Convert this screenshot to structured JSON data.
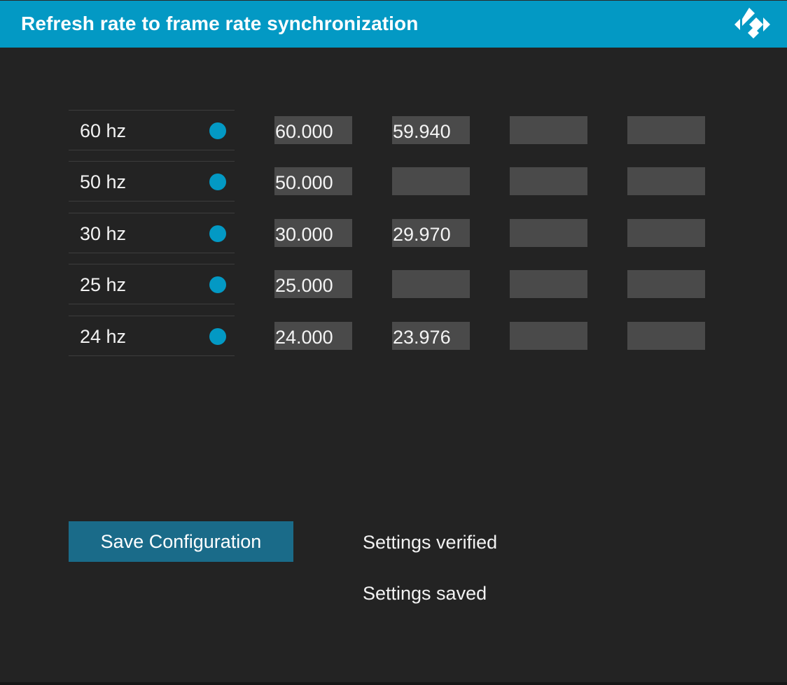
{
  "header": {
    "title": "Refresh rate to frame rate synchronization",
    "logo_icon": "kodi-logo-icon",
    "background_color": "#0399c4"
  },
  "rates": [
    {
      "label": "60 hz",
      "enabled": true,
      "fields": [
        "60.000",
        "59.940",
        "",
        ""
      ]
    },
    {
      "label": "50 hz",
      "enabled": true,
      "fields": [
        "50.000",
        "",
        "",
        ""
      ]
    },
    {
      "label": "30 hz",
      "enabled": true,
      "fields": [
        "30.000",
        "29.970",
        "",
        ""
      ]
    },
    {
      "label": "25 hz",
      "enabled": true,
      "fields": [
        "25.000",
        "",
        "",
        ""
      ]
    },
    {
      "label": "24 hz",
      "enabled": true,
      "fields": [
        "24.000",
        "23.976",
        "",
        ""
      ]
    }
  ],
  "actions": {
    "save_label": "Save Configuration"
  },
  "status": {
    "line1": "Settings verified",
    "line2": "Settings saved"
  },
  "colors": {
    "accent": "#0399c4",
    "button": "#1a6b89",
    "background": "#232323",
    "field": "#4a4a4a"
  }
}
